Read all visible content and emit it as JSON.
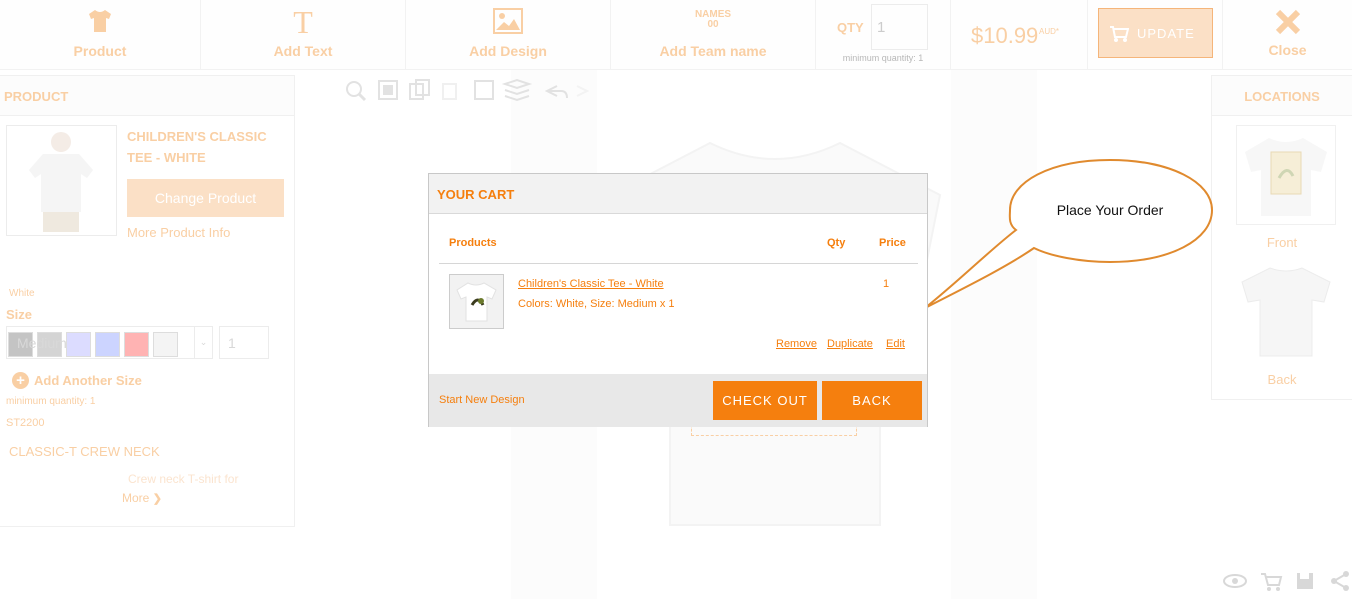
{
  "toolbar": {
    "product_label": "Product",
    "add_text_label": "Add Text",
    "add_design_label": "Add Design",
    "add_team_label": "Add Team name",
    "team_icon_text": "NAMES 00",
    "qty_label": "QTY",
    "qty_value": "1",
    "min_qty_note": "minimum quantity: 1",
    "price": "$10.99",
    "currency": "AUD*",
    "update_label": "UPDATE",
    "close_label": "Close"
  },
  "left_panel": {
    "title": "PRODUCT",
    "product_name": "CHILDREN'S CLASSIC TEE - WHITE",
    "change_product": "Change Product",
    "more_info": "More Product Info",
    "selected_color": "White",
    "size_label": "Size",
    "size_value": "Medium",
    "size_qty": "1",
    "add_size": "Add Another Size",
    "min_qty_note": "minimum quantity: 1",
    "sku": "ST2200",
    "style_name": "CLASSIC-T CREW NECK",
    "description": "Crew neck T-shirt for",
    "more": "More"
  },
  "swatches": [
    "#c0c0c0",
    "#d4d4d4",
    "#dcdcff",
    "#ccd4ff",
    "#ffb3b3",
    "#f4f4f4"
  ],
  "right_panel": {
    "title": "LOCATIONS",
    "front_label": "Front",
    "back_label": "Back"
  },
  "cart": {
    "title": "YOUR CART",
    "col_products": "Products",
    "col_qty": "Qty",
    "col_price": "Price",
    "item_name": "Children's Classic Tee - White",
    "item_details": "Colors: White, Size: Medium x 1",
    "item_qty": "1",
    "remove": "Remove",
    "duplicate": "Duplicate",
    "edit": "Edit",
    "start_new": "Start New Design",
    "checkout": "CHECK OUT",
    "back": "BACK"
  },
  "callout": {
    "text": "Place Your Order"
  },
  "colors": {
    "accent": "#f57f0e",
    "accent_faded": "#f9cfa4"
  }
}
